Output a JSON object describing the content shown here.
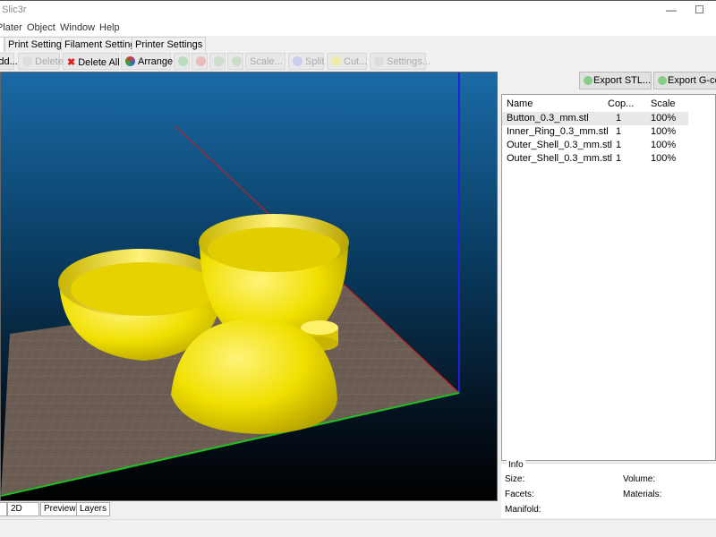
{
  "window": {
    "title": "Slic3r"
  },
  "menu": [
    "Plater",
    "Object",
    "Window",
    "Help"
  ],
  "tabs": [
    "Print Settings",
    "Filament Settings",
    "Printer Settings"
  ],
  "toolbar": [
    {
      "label": "Add...",
      "enabled": true
    },
    {
      "label": "Delete",
      "enabled": false
    },
    {
      "label": "Delete All",
      "enabled": true
    },
    {
      "label": "Arrange",
      "enabled": true
    },
    {
      "label": "Scale...",
      "enabled": false
    },
    {
      "label": "Split",
      "enabled": false
    },
    {
      "label": "Cut...",
      "enabled": false
    },
    {
      "label": "Settings...",
      "enabled": false
    }
  ],
  "export": {
    "stl": "Export STL...",
    "gcode": "Export G-code..."
  },
  "objects": {
    "columns": [
      "Name",
      "Cop...",
      "Scale"
    ],
    "rows": [
      [
        "Button_0.3_mm.stl",
        "1",
        "100%"
      ],
      [
        "Inner_Ring_0.3_mm.stl",
        "1",
        "100%"
      ],
      [
        "Outer_Shell_0.3_mm.stl",
        "1",
        "100%"
      ],
      [
        "Outer_Shell_0.3_mm.stl",
        "1",
        "100%"
      ]
    ]
  },
  "info": {
    "title": "Info",
    "size": "Size:",
    "volume": "Volume:",
    "facets": "Facets:",
    "materials": "Materials:",
    "manifold": "Manifold:"
  },
  "view_tabs": [
    "2D",
    "Preview",
    "Layers"
  ],
  "colors": {
    "model": "#f0e000",
    "x_axis": "#c02020",
    "y_axis": "#20c020",
    "z_axis": "#2020e0"
  }
}
